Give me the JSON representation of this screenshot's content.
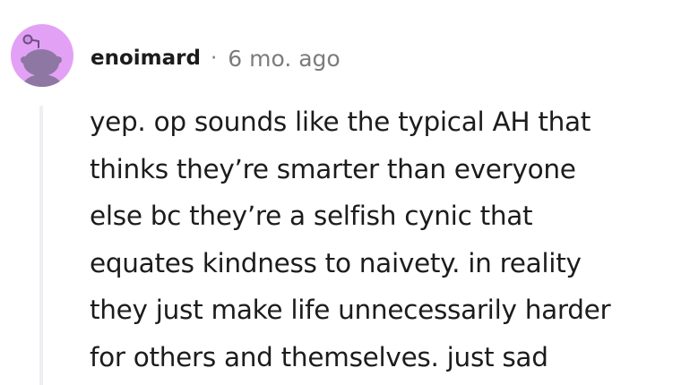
{
  "comment": {
    "author": "enoimard",
    "separator": "·",
    "timestamp": "6 mo. ago",
    "avatar_icon": "snoo-avatar-icon",
    "avatar_color": "#e3a1f5",
    "body_lines": [
      "yep. op sounds like the typical AH that",
      "thinks they’re smarter than everyone",
      "else bc they’re a selfish cynic that",
      "equates kindness to naivety. in reality",
      "they just make life unnecessarily harder",
      "for others and themselves. just sad"
    ]
  }
}
